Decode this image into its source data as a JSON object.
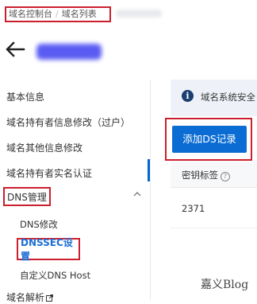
{
  "breadcrumb": {
    "console": "域名控制台",
    "separator": "/",
    "list": "域名列表"
  },
  "sidebar": {
    "items": [
      {
        "label": "基本信息"
      },
      {
        "label": "域名持有者信息修改（过户）"
      },
      {
        "label": "域名其他信息修改"
      },
      {
        "label": "域名持有者实名认证"
      }
    ],
    "dns_group": "DNS管理",
    "dns_children": [
      {
        "label": "DNS修改"
      },
      {
        "label": "DNSSEC设置"
      },
      {
        "label": "自定义DNS Host"
      }
    ],
    "last_item": "域名解析"
  },
  "main": {
    "info_icon": "i",
    "info_text": "域名系统安全",
    "add_button": "添加DS记录",
    "table_header": "密钥标签",
    "help_icon": "?",
    "row_value": "2371"
  },
  "watermark": "嘉义Blog",
  "colors": {
    "accent": "#0b6dd4",
    "highlight_border": "#cc1f2d",
    "active_link": "#1d6fd6"
  }
}
